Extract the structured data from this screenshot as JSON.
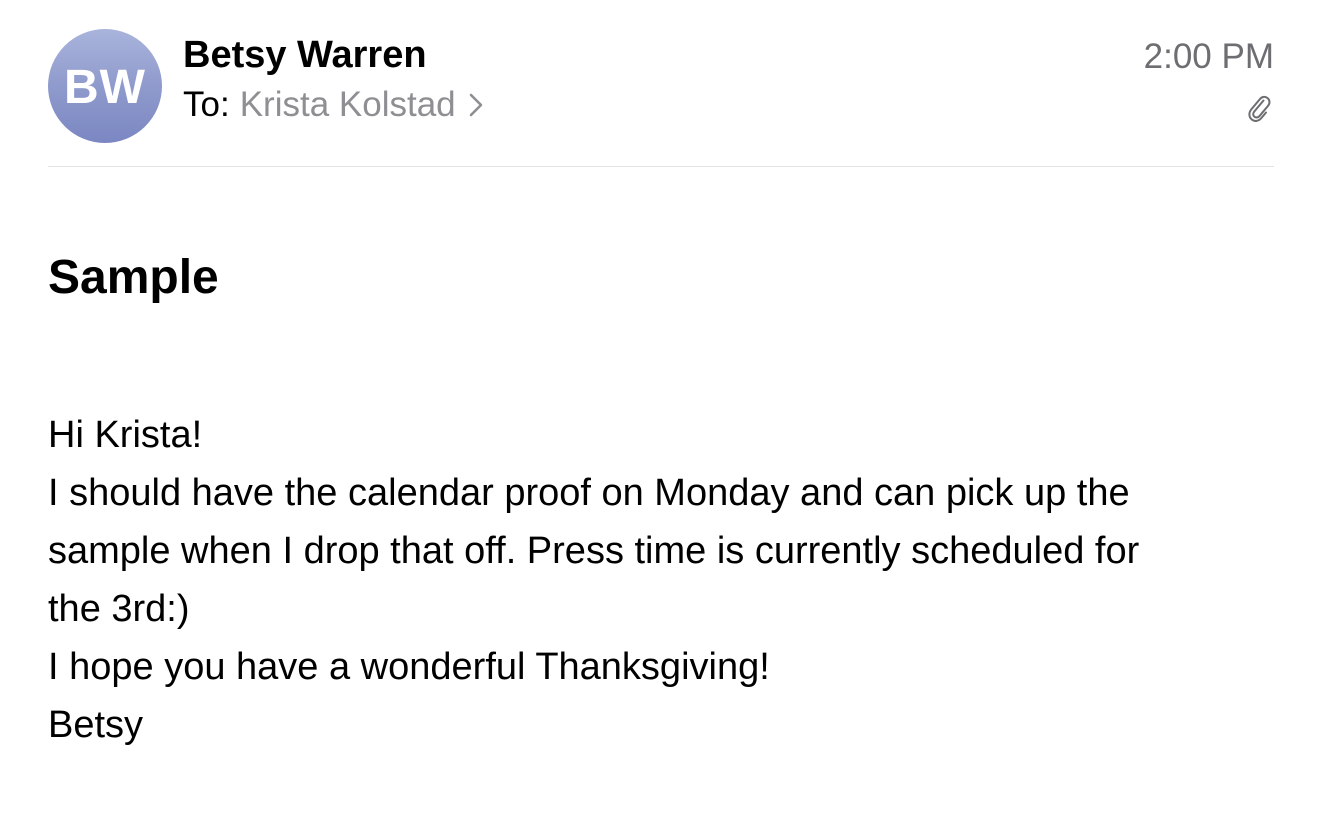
{
  "message": {
    "sender": {
      "initials": "BW",
      "name": "Betsy Warren"
    },
    "recipient": {
      "label": "To:",
      "name": "Krista Kolstad"
    },
    "time": "2:00 PM",
    "subject": "Sample",
    "body_lines": [
      "Hi Krista!",
      "I should have the calendar proof on Monday and can pick up the",
      "sample when I drop that off. Press time is currently scheduled for",
      "the 3rd:)",
      "I hope you have a wonderful Thanksgiving!",
      "Betsy"
    ]
  },
  "icons": {
    "chevron": "chevron-right-icon",
    "attachment": "paperclip-icon"
  },
  "colors": {
    "avatar_top": "#a9b4dc",
    "avatar_bottom": "#7b87c2",
    "secondary_text": "#8e8e93",
    "time_text": "#6d6d72",
    "divider": "#e3e3e6"
  }
}
